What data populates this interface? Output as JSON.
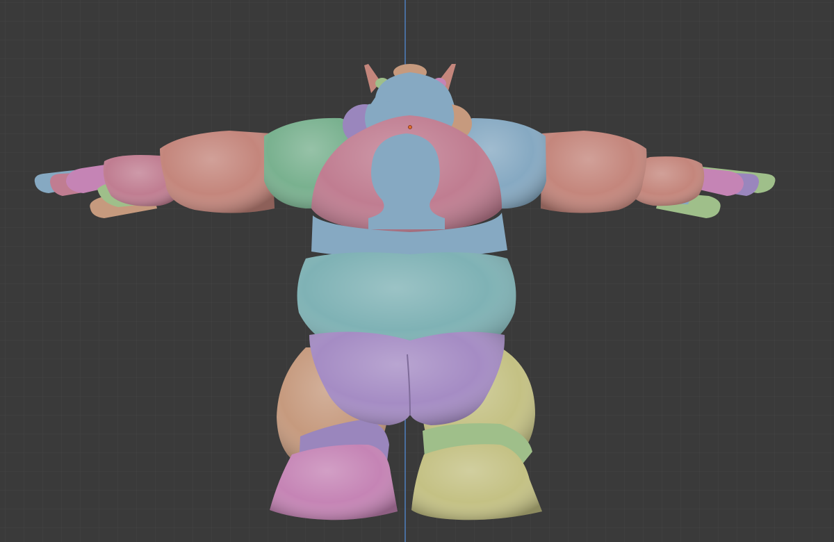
{
  "viewport": {
    "background": "#3a3a3a",
    "grid_minor_color": "#444444",
    "grid_major_color": "#4c4c4c",
    "axis_color": "#4e7fbf"
  },
  "model": {
    "pose": "T-pose",
    "view": "back",
    "patch_colors": {
      "teal": "#7fb2b5",
      "blue": "#86a9c2",
      "green": "#79b18f",
      "pink": "#c07d91",
      "salmon": "#c4867c",
      "peach": "#c69a7e",
      "purple": "#9a86bd",
      "lavender": "#a58cc4",
      "olive": "#b9b77d",
      "lightgreen": "#9fbf8a",
      "magenta": "#c584b5",
      "yellow": "#c4c184"
    },
    "origin_marker_color": "#e0702a"
  }
}
